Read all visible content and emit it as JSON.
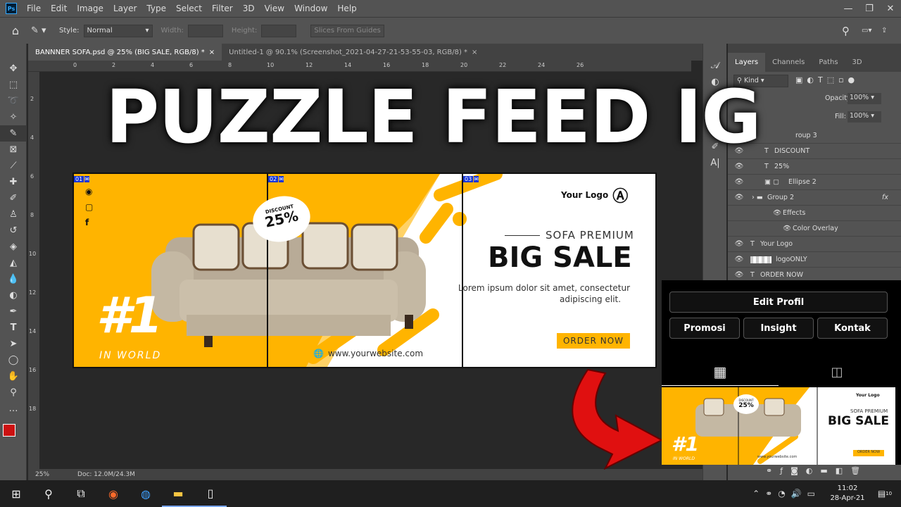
{
  "app": {
    "menu": [
      "File",
      "Edit",
      "Image",
      "Layer",
      "Type",
      "Select",
      "Filter",
      "3D",
      "View",
      "Window",
      "Help"
    ],
    "logo": "Ps",
    "options": {
      "style_label": "Style:",
      "style_value": "Normal",
      "width_label": "Width:",
      "height_label": "Height:",
      "slices_btn": "Slices From Guides"
    },
    "tabs": [
      {
        "label": "BANNNER SOFA.psd @ 25% (BIG SALE, RGB/8) *",
        "close": "×"
      },
      {
        "label": "Untitled-1 @ 90.1% (Screenshot_2021-04-27-21-53-55-03, RGB/8) *",
        "close": "×"
      }
    ],
    "ruler": [
      "0",
      "2",
      "4",
      "6",
      "8",
      "10",
      "12",
      "14",
      "16",
      "18",
      "20",
      "22",
      "24",
      "26"
    ],
    "ruler_left": [
      "2",
      "4",
      "6",
      "8",
      "10",
      "12",
      "14",
      "16",
      "18"
    ],
    "status": {
      "zoom": "25%",
      "doc": "Doc: 12.0M/24.3M"
    },
    "layers_panel": {
      "tabs": [
        "Layers",
        "Channels",
        "Paths",
        "3D"
      ],
      "kind": "Kind",
      "opacity_label": "Opacity:",
      "opacity_value": "100%",
      "fill_label": "Fill:",
      "fill_value": "100%",
      "rows": [
        "roup 3",
        "DISCOUNT",
        "25%",
        "Ellipse 2",
        "Group 2",
        "Effects",
        "Color Overlay",
        "Your Logo",
        "logoONLY",
        "ORDER NOW"
      ],
      "fx": "fx"
    }
  },
  "headline": "PUZZLE FEED IG",
  "banner": {
    "slices": [
      "01",
      "02",
      "03"
    ],
    "rank": "#1",
    "rank_sub": "IN WORLD",
    "discount_label": "DISCOUNT",
    "discount_value": "25%",
    "logo": "Your Logo",
    "subtitle": "SOFA PREMIUM",
    "title": "BIG SALE",
    "desc1": "Lorem ipsum dolor sit amet, consectetur",
    "desc2": "adipiscing elit.",
    "cta": "ORDER NOW",
    "website": "www.yourwebsite.com"
  },
  "instagram": {
    "edit": "Edit Profil",
    "buttons": [
      "Promosi",
      "Insight",
      "Kontak"
    ]
  },
  "taskbar": {
    "time": "11:02",
    "date": "28-Apr-21",
    "notif": "10"
  },
  "colors": {
    "accent": "#FFB400",
    "arrow": "#E01010",
    "ps_bg": "#535353"
  }
}
